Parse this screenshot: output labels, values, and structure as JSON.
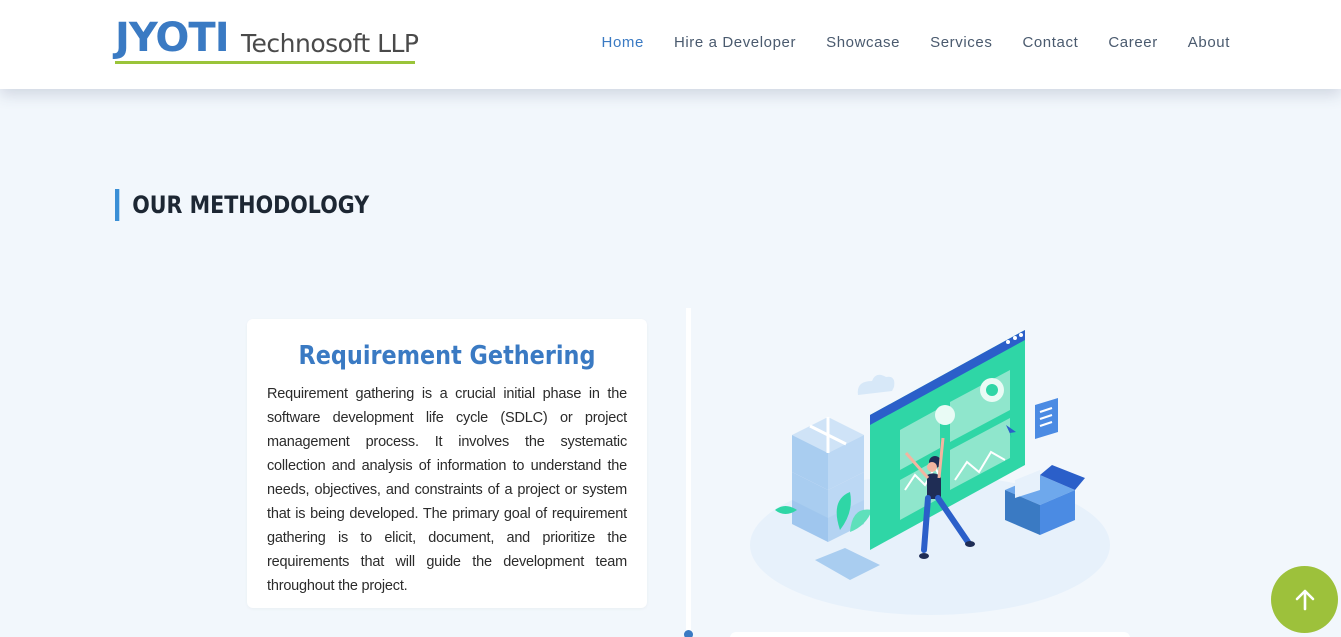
{
  "brand": {
    "name_main": "JYOTI",
    "name_sub": "Technosoft LLP"
  },
  "nav": {
    "items": [
      {
        "label": "Home",
        "active": true
      },
      {
        "label": "Hire a Developer",
        "active": false
      },
      {
        "label": "Showcase",
        "active": false
      },
      {
        "label": "Services",
        "active": false
      },
      {
        "label": "Contact",
        "active": false
      },
      {
        "label": "Career",
        "active": false
      },
      {
        "label": "About",
        "active": false
      }
    ]
  },
  "section": {
    "title": "OUR METHODOLOGY"
  },
  "steps": [
    {
      "title": "Requirement Gethering",
      "body": "Requirement gathering is a crucial initial phase in the software development life cycle (SDLC) or project management process. It involves the systematic collection and analysis of information to understand the needs, objectives, and constraints of a project or system that is being developed. The primary goal of requirement gathering is to elicit, document, and prioritize the requirements that will guide the development team throughout the project.",
      "illustration": "person-dashboard-illustration"
    }
  ],
  "scroll_top": {
    "icon": "arrow-up-icon"
  },
  "colors": {
    "brand_blue": "#3a7ac3",
    "brand_green": "#9ac43a",
    "background": "#f2f7fc",
    "accent_teal": "#2fd6a6"
  }
}
